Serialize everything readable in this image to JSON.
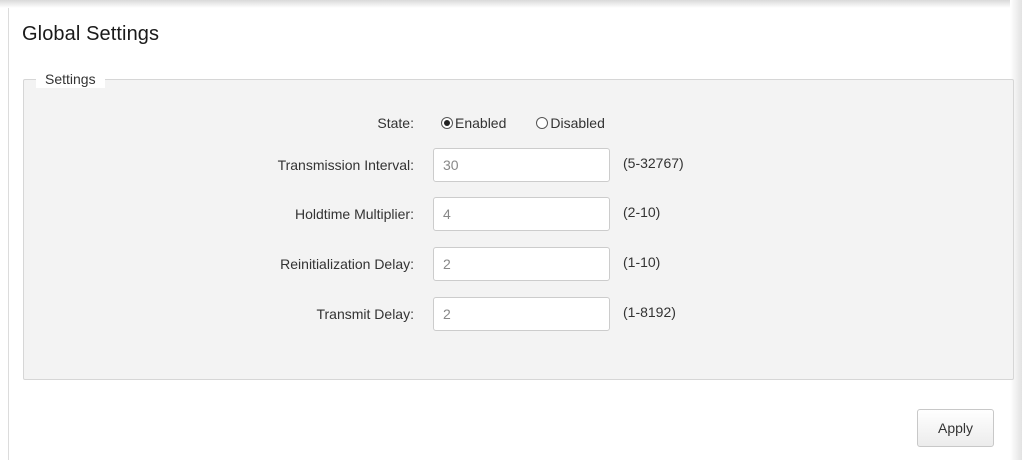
{
  "page": {
    "title": "Global Settings"
  },
  "settings": {
    "legend": "Settings",
    "state": {
      "label": "State:",
      "options": [
        {
          "label": "Enabled",
          "selected": true
        },
        {
          "label": "Disabled",
          "selected": false
        }
      ]
    },
    "fields": [
      {
        "label": "Transmission Interval:",
        "value": "30",
        "range": "(5-32767)"
      },
      {
        "label": "Holdtime Multiplier:",
        "value": "4",
        "range": "(2-10)"
      },
      {
        "label": "Reinitialization Delay:",
        "value": "2",
        "range": "(1-10)"
      },
      {
        "label": "Transmit Delay:",
        "value": "2",
        "range": "(1-8192)"
      }
    ]
  },
  "actions": {
    "apply_label": "Apply"
  }
}
